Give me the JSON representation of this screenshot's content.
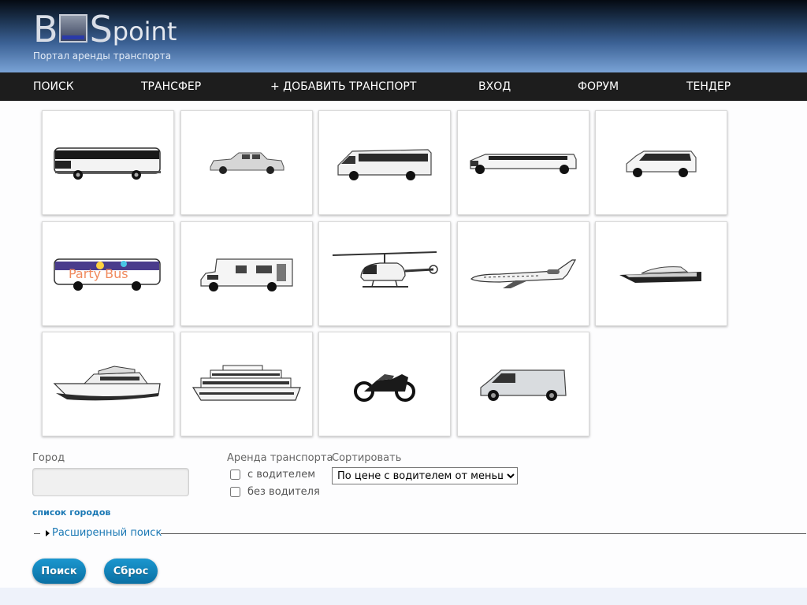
{
  "brand": {
    "logo_b": "B",
    "logo_s": "S",
    "logo_point": "point",
    "tagline": "Портал аренды транспорта"
  },
  "nav": {
    "items": [
      {
        "label": "ПОИСК"
      },
      {
        "label": "ТРАНСФЕР"
      },
      {
        "label": "+ ДОБАВИТЬ ТРАНСПОРТ"
      },
      {
        "label": "ВХОД"
      },
      {
        "label": "ФОРУМ"
      },
      {
        "label": "ТЕНДЕР"
      }
    ]
  },
  "vehicles": [
    {
      "icon": "coach-bus-icon"
    },
    {
      "icon": "retro-limousine-icon"
    },
    {
      "icon": "minibus-icon"
    },
    {
      "icon": "stretch-limousine-icon"
    },
    {
      "icon": "minivan-icon"
    },
    {
      "icon": "party-bus-icon"
    },
    {
      "icon": "motorhome-icon"
    },
    {
      "icon": "helicopter-icon"
    },
    {
      "icon": "business-jet-icon"
    },
    {
      "icon": "speedboat-icon"
    },
    {
      "icon": "motor-yacht-icon"
    },
    {
      "icon": "river-ship-icon"
    },
    {
      "icon": "motorcycle-icon"
    },
    {
      "icon": "cargo-van-icon"
    }
  ],
  "party_bus_text": "Party Bus",
  "filters": {
    "city_label": "Город",
    "city_value": "",
    "city_list_link": "список городов",
    "rent_label": "Аренда транспорта",
    "with_driver": "с водителем",
    "without_driver": "без водителя",
    "sort_label": "Сортировать",
    "sort_selected": "По цене с водителем от меньшей",
    "advanced_search": "Расширенный поиск"
  },
  "buttons": {
    "search": "Поиск",
    "reset": "Сброс"
  },
  "colors": {
    "nav_bg": "#1d1d1d",
    "button": "#1489c0",
    "link": "#1a78b4"
  }
}
